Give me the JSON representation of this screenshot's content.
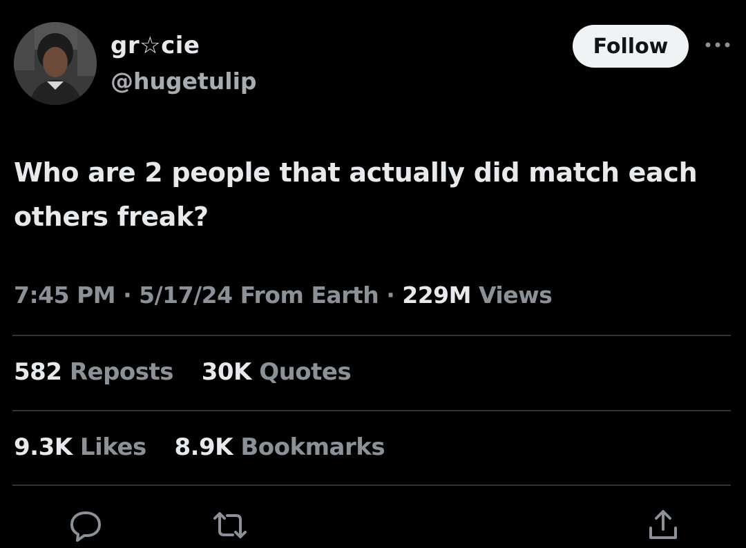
{
  "user": {
    "display_name": "gr☆cie",
    "handle": "@hugetulip"
  },
  "follow_label": "Follow",
  "more_label": "···",
  "tweet": {
    "text": "Who are 2 people that actually did match each others freak?"
  },
  "meta": {
    "time": "7:45 PM",
    "sep": "·",
    "date": "5/17/24",
    "source": "From Earth",
    "views_count": "229M",
    "views_label": "Views"
  },
  "stats": {
    "reposts_count": "582",
    "reposts_label": "Reposts",
    "quotes_count": "30K",
    "quotes_label": "Quotes",
    "likes_count": "9.3K",
    "likes_label": "Likes",
    "bookmarks_count": "8.9K",
    "bookmarks_label": "Bookmarks"
  },
  "actions": [
    "reply-icon",
    "repost-icon",
    "share-icon"
  ],
  "colors": {
    "background": "#000000",
    "primary_text": "#e7e9ea",
    "secondary_text": "#8b9196",
    "divider": "#2f3336",
    "follow_bg": "#eff3f4"
  }
}
